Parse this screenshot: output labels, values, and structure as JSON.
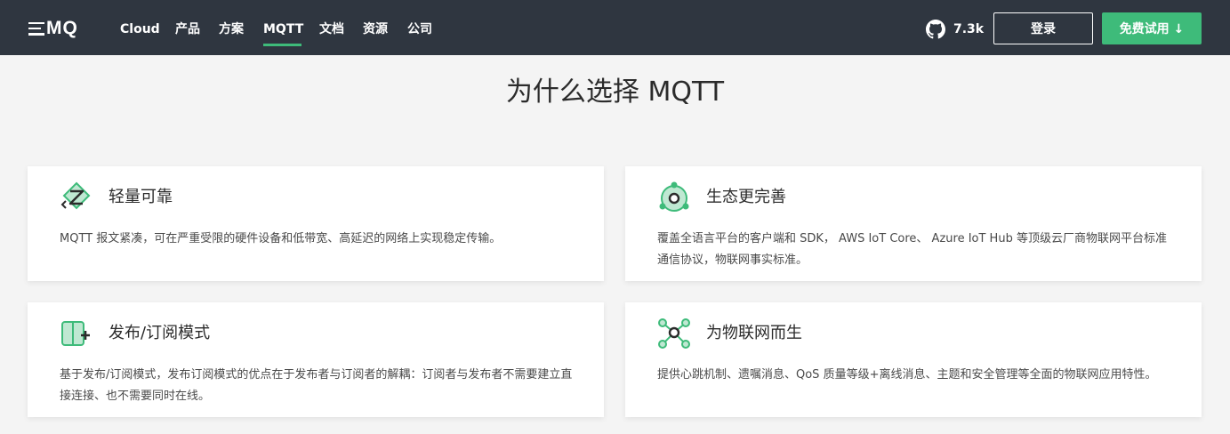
{
  "brand": {
    "logo_text": "MQ"
  },
  "nav": {
    "items": [
      "Cloud",
      "产品",
      "方案",
      "MQTT",
      "文档",
      "资源",
      "公司"
    ],
    "active": "MQTT"
  },
  "github": {
    "stars": "7.3k"
  },
  "actions": {
    "login_label": "登录",
    "trial_label": "免费试用 ↓"
  },
  "page": {
    "title": "为什么选择 MQTT"
  },
  "features": [
    {
      "icon": "lightweight-icon",
      "title": "轻量可靠",
      "description": "MQTT 报文紧凑，可在严重受限的硬件设备和低带宽、高延迟的网络上实现稳定传输。"
    },
    {
      "icon": "ecosystem-icon",
      "title": "生态更完善",
      "description": "覆盖全语言平台的客户端和 SDK， AWS IoT Core、 Azure IoT Hub 等顶级云厂商物联网平台标准通信协议，物联网事实标准。"
    },
    {
      "icon": "pubsub-icon",
      "title": "发布/订阅模式",
      "description": "基于发布/订阅模式，发布订阅模式的优点在于发布者与订阅者的解耦：订阅者与发布者不需要建立直接连接、也不需要同时在线。"
    },
    {
      "icon": "iot-icon",
      "title": "为物联网而生",
      "description": "提供心跳机制、遗嘱消息、QoS 质量等级+离线消息、主题和安全管理等全面的物联网应用特性。"
    }
  ],
  "colors": {
    "navbar_bg": "#2f3640",
    "accent": "#3ebb7a",
    "page_bg": "#f4f4f4"
  }
}
